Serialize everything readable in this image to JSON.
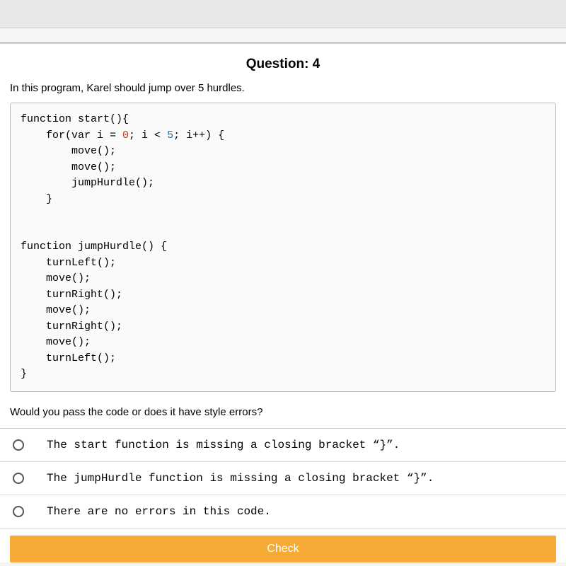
{
  "question": {
    "title": "Question: 4",
    "prompt": "In this program, Karel should jump over 5 hurdles.",
    "sub_prompt": "Would you pass the code or does it have style errors?"
  },
  "code": {
    "line1": "function start(){",
    "line2_a": "    for(var i = ",
    "line2_zero": "0",
    "line2_b": "; i < ",
    "line2_five": "5",
    "line2_c": "; i++) {",
    "line3": "        move();",
    "line4": "        move();",
    "line5": "        jumpHurdle();",
    "line6": "    }",
    "line7": "",
    "line8": "",
    "line9": "function jumpHurdle() {",
    "line10": "    turnLeft();",
    "line11": "    move();",
    "line12": "    turnRight();",
    "line13": "    move();",
    "line14": "    turnRight();",
    "line15": "    move();",
    "line16": "    turnLeft();",
    "line17": "}"
  },
  "options": [
    "The start function is missing a closing bracket “}”.",
    "The jumpHurdle function is missing a closing bracket “}”.",
    "There are no errors in this code."
  ],
  "check_label": "Check"
}
